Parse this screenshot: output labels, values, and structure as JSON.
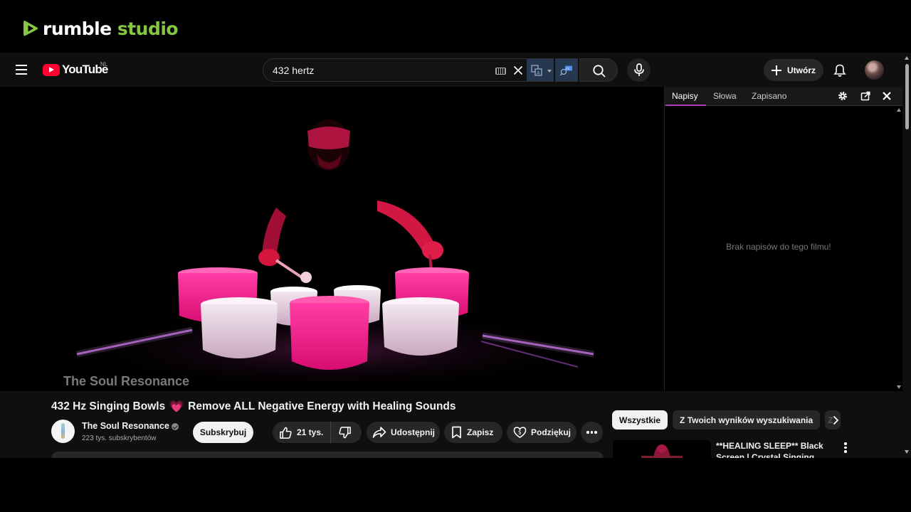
{
  "brand": {
    "rumble_part1": "rumble",
    "rumble_part2": "studio"
  },
  "masthead": {
    "logo_text": "YouTube",
    "country_code": "NL",
    "search": {
      "value": "432 hertz"
    },
    "create_label": "Utwórz"
  },
  "player": {
    "watermark": "The Soul Resonance"
  },
  "transcript_panel": {
    "tabs": [
      {
        "label": "Napisy",
        "active": true
      },
      {
        "label": "Słowa",
        "active": false
      },
      {
        "label": "Zapisano",
        "active": false
      }
    ],
    "empty_message": "Brak napisów do tego filmu!",
    "accent_color": "#b03ab8"
  },
  "video": {
    "title_part1": "432 Hz Singing Bowls",
    "title_emoji": "💗",
    "title_part2": "Remove ALL Negative Energy with Healing Sounds",
    "channel": {
      "name": "The Soul Resonance",
      "subscribers": "223 tys. subskrybentów",
      "subscribe_label": "Subskrybuj"
    },
    "actions": {
      "likes": "21 tys.",
      "share": "Udostępnij",
      "save": "Zapisz",
      "thanks": "Podziękuj"
    }
  },
  "chips": {
    "items": [
      "Wszystkie",
      "Z Twoich wyników wyszukiwania"
    ],
    "active_index": 0
  },
  "recommendation": {
    "title": "**HEALING SLEEP** Black Screen | Crystal Singing Bowls"
  },
  "colors": {
    "youtube_red": "#ff0033",
    "rumble_green": "#85c742",
    "bowl_pink": "#e0157a"
  }
}
